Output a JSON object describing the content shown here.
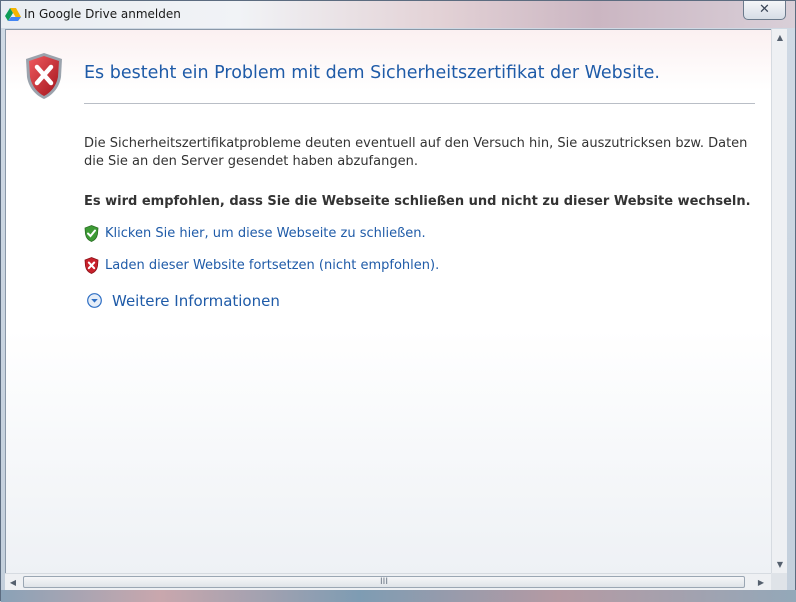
{
  "window": {
    "title": "In Google Drive anmelden",
    "close_glyph": "✕"
  },
  "page": {
    "heading": "Es besteht ein Problem mit dem Sicherheitszertifikat der Website.",
    "description": "Die Sicherheitszertifikatprobleme deuten eventuell auf den Versuch hin, Sie auszutricksen bzw. Daten die Sie an den Server gesendet haben abzufangen.",
    "recommendation": "Es wird empfohlen, dass Sie die Webseite schließen und nicht zu dieser Website wechseln.",
    "close_link": "Klicken Sie hier, um diese Webseite zu schließen.",
    "continue_link": "Laden dieser Website fortsetzen (nicht empfohlen).",
    "more_info": "Weitere Informationen"
  },
  "icons": {
    "app": "google-drive-icon",
    "error": "error-shield-icon",
    "safe": "green-shield-check-icon",
    "unsafe": "red-shield-x-icon",
    "expand": "chevron-down-circle-icon"
  },
  "scrollbar": {
    "up_glyph": "▲",
    "down_glyph": "▼",
    "left_glyph": "◀",
    "right_glyph": "▶",
    "grip": "III"
  },
  "colors": {
    "link": "#1f5ba8",
    "error_red": "#c8212b",
    "safe_green": "#3d9b35"
  }
}
